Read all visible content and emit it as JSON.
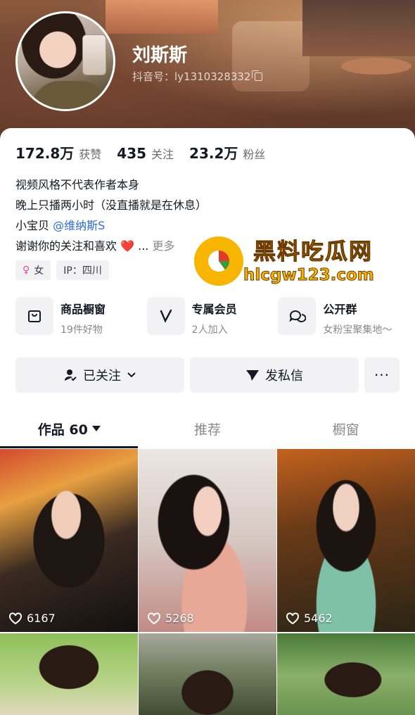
{
  "profile": {
    "nickname": "刘斯斯",
    "douyin_id": "抖音号：ly1310328332"
  },
  "stats": [
    {
      "value": "172.8万",
      "label": "获赞"
    },
    {
      "value": "435",
      "label": "关注"
    },
    {
      "value": "23.2万",
      "label": "粉丝"
    }
  ],
  "bio": {
    "line1": "视频风格不代表作者本身",
    "line2": "晚上只播两小时（没直播就是在休息）",
    "line3_prefix": "小宝贝",
    "line3_mention": "@维纳斯S",
    "line4": "谢谢你的关注和喜欢",
    "line4_emoji": "❤️",
    "line4_ellipsis": "...",
    "more": "更多"
  },
  "tags": {
    "gender": "女",
    "ip": "IP：四川"
  },
  "features": [
    {
      "title": "商品橱窗",
      "sub": "19件好物",
      "icon": "shopping-bag-icon"
    },
    {
      "title": "专属会员",
      "sub": "2人加入",
      "icon": "v-badge-icon"
    },
    {
      "title": "公开群",
      "sub": "女粉宝聚集地～",
      "icon": "chat-bubbles-icon"
    }
  ],
  "actions": {
    "follow": "已关注",
    "message": "发私信",
    "more": "···"
  },
  "tabs": {
    "works": "作品 60",
    "recommend": "推荐",
    "showcase": "橱窗"
  },
  "videos": [
    {
      "likes": "6167"
    },
    {
      "likes": "5268"
    },
    {
      "likes": "5462"
    }
  ],
  "watermark": {
    "title": "黑料吃瓜网",
    "url": "hlcgw123.com"
  },
  "colors": {
    "accent_link": "#2f6bd4",
    "watermark": "#f7b500"
  }
}
